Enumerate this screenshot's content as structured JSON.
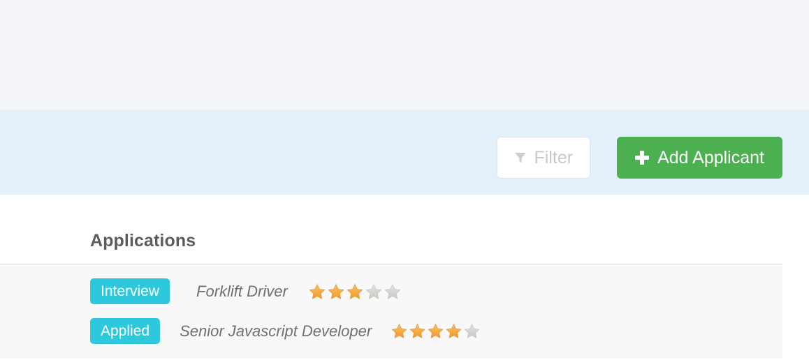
{
  "theme": {
    "top_band_color": "#f4f5f8",
    "action_bar_color": "#e1f0fb",
    "panel_color": "#ffffff",
    "row_strip_color": "#f8f8f8",
    "divider_color": "#dcdcdc",
    "accent_green": "#4caf50",
    "accent_cyan": "#2ec8dd",
    "star_filled_color": "#f5a623",
    "star_empty_color": "#d4d4d2",
    "heading_color": "#5a5d60",
    "muted_text_color": "#c5c8cc"
  },
  "action_bar": {
    "filter_button": {
      "label": "Filter",
      "icon": "filter-funnel-icon"
    },
    "add_applicant_button": {
      "label": "Add Applicant",
      "icon": "plus-icon"
    }
  },
  "panel": {
    "title": "Applications",
    "rows": [
      {
        "status": "Interview",
        "job_title": "Forklift Driver",
        "rating": 3,
        "rating_max": 5
      },
      {
        "status": "Applied",
        "job_title": "Senior Javascript Developer",
        "rating": 4,
        "rating_max": 5
      }
    ]
  }
}
